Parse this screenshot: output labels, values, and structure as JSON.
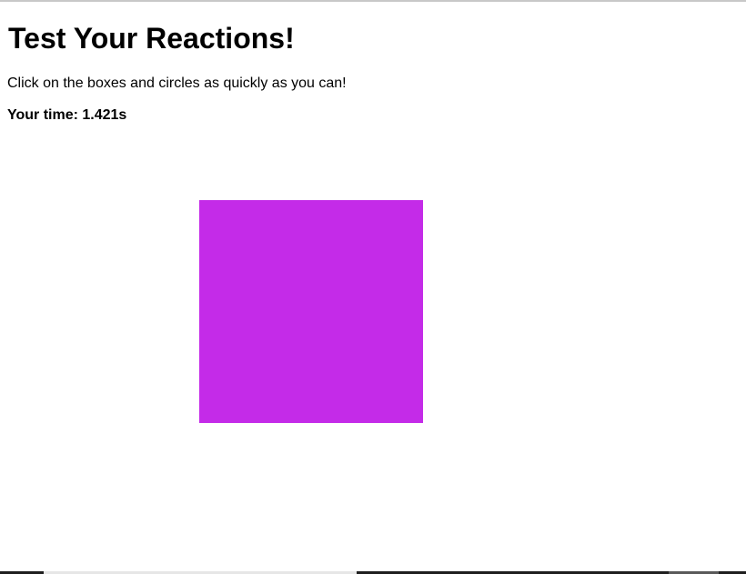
{
  "game": {
    "title": "Test Your Reactions!",
    "instructions": "Click on the boxes and circles as quickly as you can!",
    "time_label": "Your time:",
    "time_value": "1.421s"
  },
  "target": {
    "shape": "square",
    "color": "#c42be8"
  }
}
